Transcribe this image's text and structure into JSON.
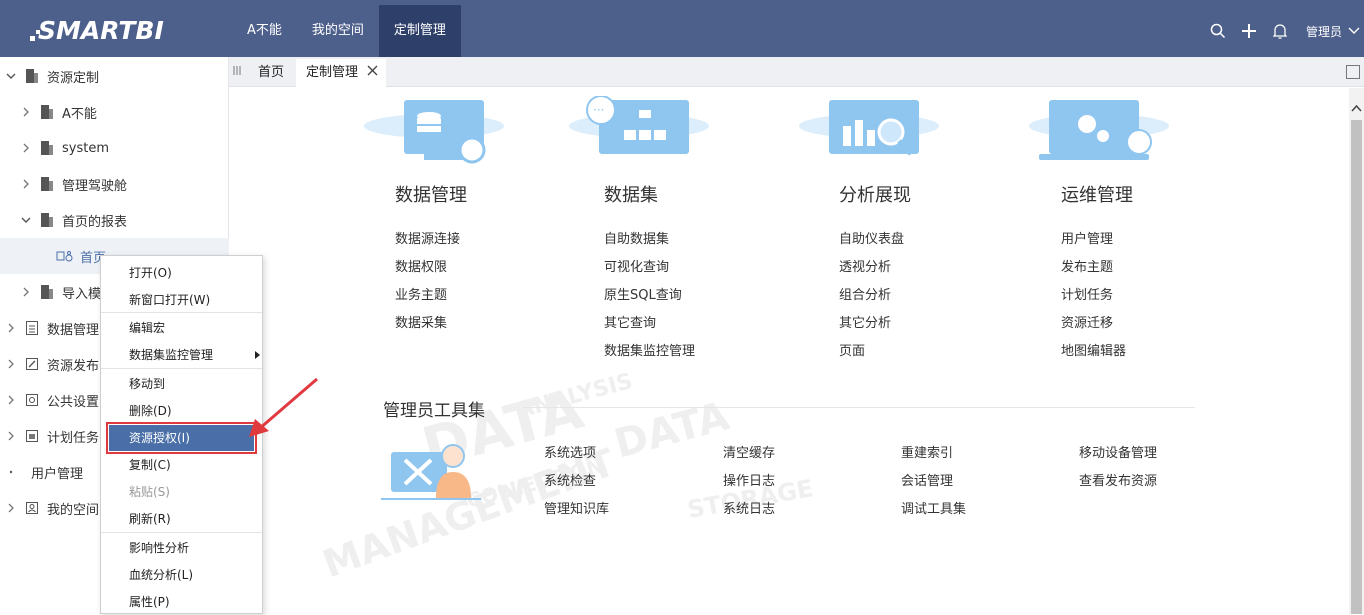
{
  "header": {
    "logo": "SMARTBI",
    "nav": [
      "A不能",
      "我的空间",
      "定制管理"
    ],
    "active_nav": "定制管理",
    "user": "管理员"
  },
  "sidebar": {
    "items": [
      {
        "label": "资源定制",
        "level": 0,
        "expanded": true
      },
      {
        "label": "A不能",
        "level": 1
      },
      {
        "label": "system",
        "level": 1
      },
      {
        "label": "管理驾驶舱",
        "level": 1
      },
      {
        "label": "首页的报表",
        "level": 1,
        "expanded": true
      },
      {
        "label": "首页",
        "level": 2,
        "selected": true
      },
      {
        "label": "导入模",
        "level": 1
      },
      {
        "label": "数据管理",
        "level": 0
      },
      {
        "label": "资源发布",
        "level": 0
      },
      {
        "label": "公共设置",
        "level": 0
      },
      {
        "label": "计划任务",
        "level": 0
      },
      {
        "label": "用户管理",
        "level": 0
      },
      {
        "label": "我的空间",
        "level": 0
      }
    ]
  },
  "tabs": [
    "首页",
    "定制管理"
  ],
  "modules": [
    {
      "title": "数据管理",
      "links": [
        "数据源连接",
        "数据权限",
        "业务主题",
        "数据采集"
      ]
    },
    {
      "title": "数据集",
      "links": [
        "自助数据集",
        "可视化查询",
        "原生SQL查询",
        "其它查询",
        "数据集监控管理"
      ]
    },
    {
      "title": "分析展现",
      "links": [
        "自助仪表盘",
        "透视分析",
        "组合分析",
        "其它分析",
        "页面"
      ]
    },
    {
      "title": "运维管理",
      "links": [
        "用户管理",
        "发布主题",
        "计划任务",
        "资源迁移",
        "地图编辑器"
      ]
    }
  ],
  "admin_tools": {
    "title": "管理员工具集",
    "columns": [
      [
        "系统选项",
        "系统检查",
        "管理知识库"
      ],
      [
        "清空缓存",
        "操作日志",
        "系统日志"
      ],
      [
        "重建索引",
        "会话管理",
        "调试工具集"
      ],
      [
        "移动设备管理",
        "查看发布资源"
      ]
    ]
  },
  "context_menu": {
    "items": [
      {
        "label": "打开(O)"
      },
      {
        "label": "新窗口打开(W)"
      },
      {
        "label": "编辑宏"
      },
      {
        "label": "数据集监控管理",
        "submenu": true
      },
      {
        "label": "移动到"
      },
      {
        "label": "删除(D)"
      },
      {
        "label": "资源授权(I)",
        "highlighted": true
      },
      {
        "label": "复制(C)"
      },
      {
        "label": "粘贴(S)",
        "disabled": true
      },
      {
        "label": "刷新(R)"
      },
      {
        "label": "影响性分析"
      },
      {
        "label": "血统分析(L)"
      },
      {
        "label": "属性(P)"
      }
    ]
  },
  "colors": {
    "header_bg": "#4d5f8b",
    "nav_active_bg": "#2e3f6a",
    "menu_highlight": "#4a6fa8",
    "callout_red": "#e0393e",
    "illustration_blue": "#8fc6f0"
  }
}
